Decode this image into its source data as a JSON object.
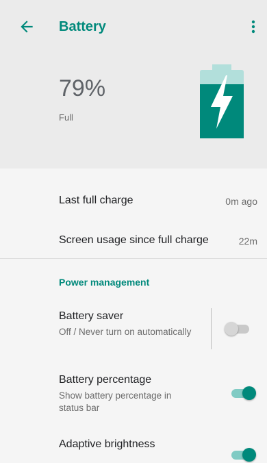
{
  "toolbar": {
    "title": "Battery",
    "back_icon": "arrow-back-icon",
    "more_icon": "more-vert-icon"
  },
  "battery": {
    "level_text": "79%",
    "level_fraction": 0.79,
    "status": "Full",
    "icon": "battery-charging-icon"
  },
  "stats": [
    {
      "label": "Last full charge",
      "value": "0m ago"
    },
    {
      "label": "Screen usage since full charge",
      "value": "22m"
    }
  ],
  "power_management": {
    "header": "Power management",
    "items": [
      {
        "title": "Battery saver",
        "summary": "Off / Never turn on automatically",
        "enabled": false
      },
      {
        "title": "Battery percentage",
        "summary": "Show battery percentage in status bar",
        "enabled": true
      },
      {
        "title": "Adaptive brightness",
        "summary": "",
        "enabled": true
      }
    ]
  },
  "colors": {
    "accent": "#00897b",
    "accent_light": "#80cbc4",
    "header_bg": "#ebebeb",
    "page_bg": "#f5f5f5"
  }
}
